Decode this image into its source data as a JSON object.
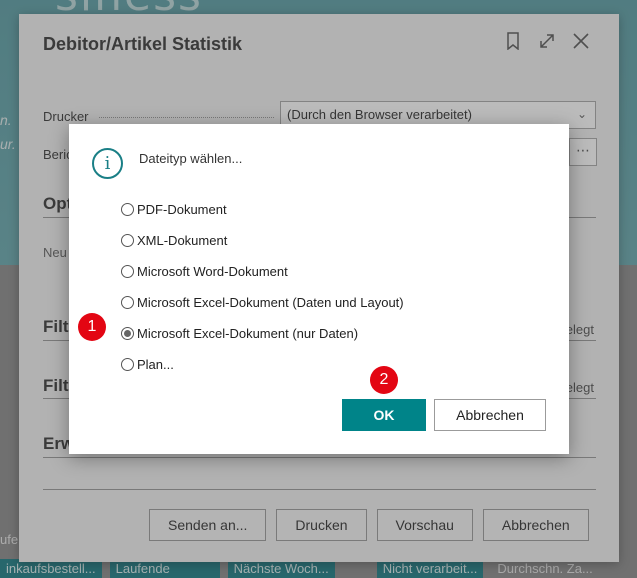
{
  "background": {
    "logo_text": "siness",
    "left_lines": [
      "n.",
      "ur."
    ],
    "bottom_left": "ufe",
    "tiles": [
      "inkaufsbestell...",
      "Laufende",
      "Nächste Woch...",
      "Nicht verarbeit...",
      "Durchschn. Za..."
    ]
  },
  "report": {
    "title": "Debitor/Artikel Statistik",
    "drucker_label": "Drucker",
    "drucker_value": "(Durch den Browser verarbeitet)",
    "bericht_label": "Beric",
    "optionen_label": "Opt",
    "neu_label": "Neu",
    "filter1_label": "Filte",
    "filter1_right": "elegt",
    "filter2_label": "Filte",
    "filter2_right": "elegt",
    "erw_label": "Erw",
    "buttons": {
      "send": "Senden an...",
      "print": "Drucken",
      "preview": "Vorschau",
      "cancel": "Abbrechen"
    }
  },
  "modal": {
    "title": "Dateityp wählen...",
    "options": [
      {
        "label": "PDF-Dokument",
        "checked": false
      },
      {
        "label": "XML-Dokument",
        "checked": false
      },
      {
        "label": "Microsoft Word-Dokument",
        "checked": false
      },
      {
        "label": "Microsoft Excel-Dokument (Daten und Layout)",
        "checked": false
      },
      {
        "label": "Microsoft Excel-Dokument (nur Daten)",
        "checked": true
      },
      {
        "label": "Plan...",
        "checked": false
      }
    ],
    "ok_label": "OK",
    "cancel_label": "Abbrechen"
  },
  "markers": {
    "one": "1",
    "two": "2"
  },
  "colors": {
    "accent": "#008489",
    "marker": "#e30613"
  }
}
